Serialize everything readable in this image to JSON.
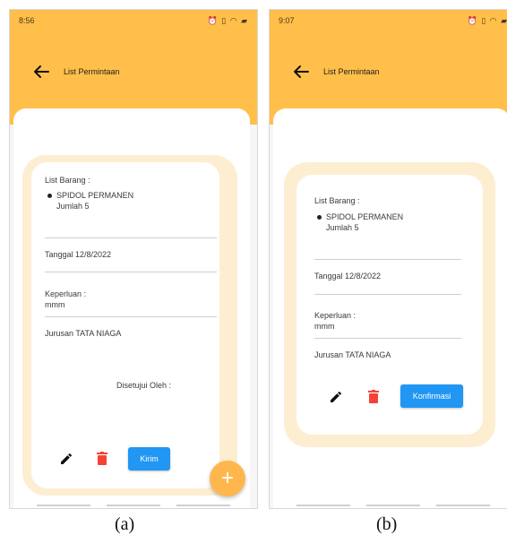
{
  "screens": [
    {
      "status_time": "8:56",
      "status_right": "⏰ ▯ ◠ ▰",
      "title": "List Permintaan",
      "list_label": "List Barang :",
      "item_name": "SPIDOL PERMANEN",
      "item_qty": "Jumlah 5",
      "date": "Tanggal 12/8/2022",
      "purpose_label": "Keperluan :",
      "purpose_value": "mmm",
      "department": "Jurusan TATA NIAGA",
      "approved_by": "Disetujui Oleh :",
      "action_label": "Kirim",
      "fab": "+",
      "caption": "(a)"
    },
    {
      "status_time": "9:07",
      "status_right": "⏰ ▯ ◠ ▰",
      "title": "List Permintaan",
      "list_label": "List Barang :",
      "item_name": "SPIDOL PERMANEN",
      "item_qty": "Jumlah 5",
      "date": "Tanggal 12/8/2022",
      "purpose_label": "Keperluan :",
      "purpose_value": "mmm",
      "department": "Jurusan TATA NIAGA",
      "action_label": "Konfirmasi",
      "caption": "(b)"
    }
  ],
  "colors": {
    "header": "#ffbf4a",
    "card_border": "#fdeed2",
    "button": "#2196f3",
    "delete": "#f44336",
    "fab": "#ffb74d"
  },
  "icons": [
    "back-arrow-icon",
    "edit-pencil-icon",
    "delete-trash-icon",
    "add-plus-icon"
  ]
}
